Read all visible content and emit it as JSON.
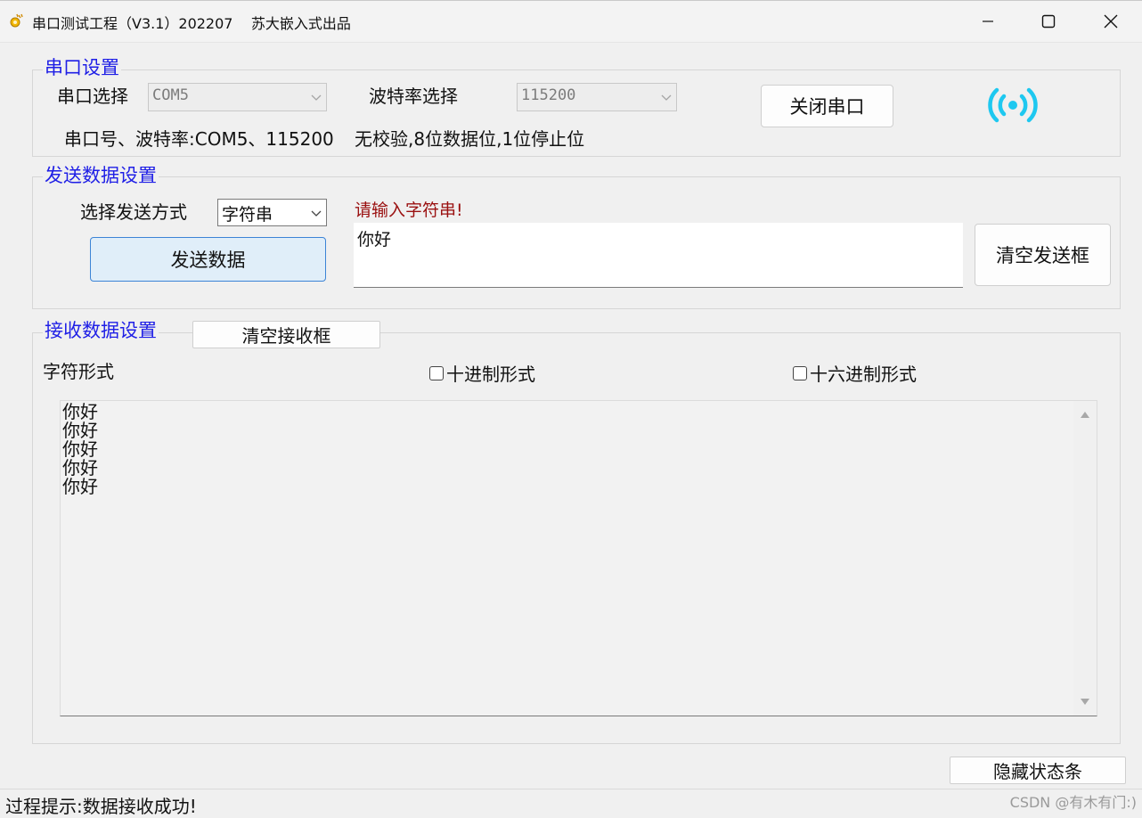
{
  "window": {
    "title": "串口测试工程（V3.1）202207    苏大嵌入式出品",
    "controls": [
      "minimize-icon",
      "maximize-icon",
      "close-icon"
    ]
  },
  "serial_settings": {
    "group_title": "串口设置",
    "port_label": "串口选择",
    "port_value": "COM5",
    "baud_label": "波特率选择",
    "baud_value": "115200",
    "close_port_button": "关闭串口",
    "port_info": "串口号、波特率:COM5、115200",
    "format_info": "无校验,8位数据位,1位停止位",
    "signal_icon": "signal-broadcast-icon",
    "signal_color": "#1ec8f0"
  },
  "send_settings": {
    "group_title": "发送数据设置",
    "mode_label": "选择发送方式",
    "mode_value": "字符串",
    "send_button": "发送数据",
    "hint": "请输入字符串!",
    "input_value": "你好",
    "clear_button": "清空发送框"
  },
  "receive_settings": {
    "group_title": "接收数据设置",
    "clear_button": "清空接收框",
    "char_format_label": "字符形式",
    "decimal_label": "十进制形式",
    "hex_label": "十六进制形式",
    "decimal_checked": false,
    "hex_checked": false,
    "lines": [
      "你好",
      "你好",
      "你好",
      "你好",
      "你好"
    ]
  },
  "footer": {
    "hide_status_button": "隐藏状态条",
    "status_text": "过程提示:数据接收成功!",
    "watermark": "CSDN @有木有门:)"
  },
  "colors": {
    "group_title": "#1f1fe6",
    "hint": "#9a1010",
    "primary_button_border": "#3c84d6"
  }
}
